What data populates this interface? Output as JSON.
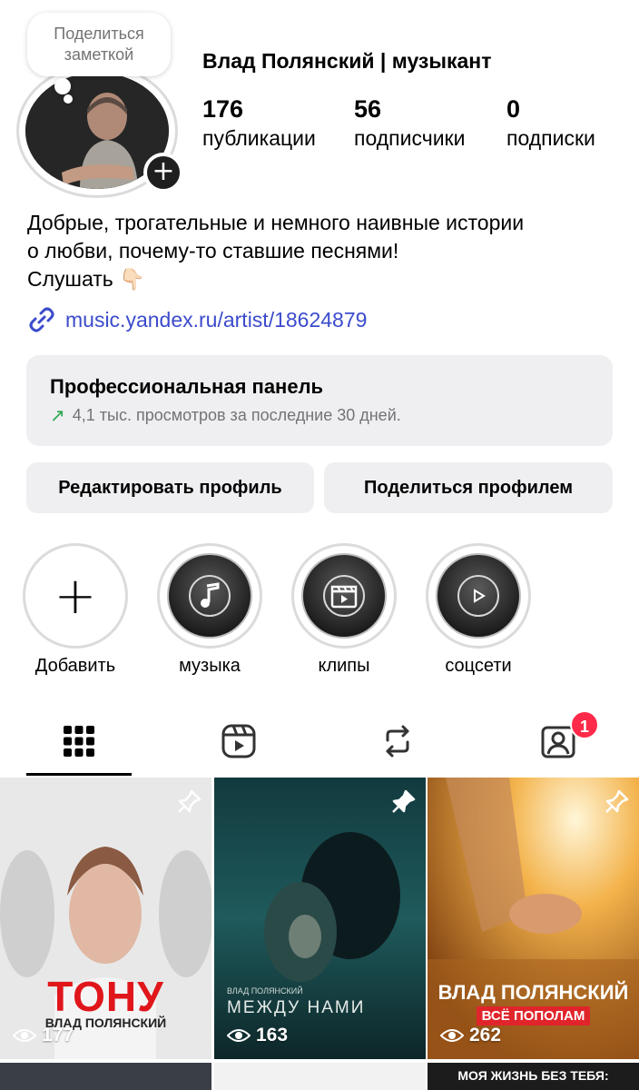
{
  "note": {
    "text_line1": "Поделиться",
    "text_line2": "заметкой"
  },
  "profile": {
    "name": "Влад Полянский | музыкант",
    "stats": {
      "posts_count": "176",
      "posts_label": "публикации",
      "followers_count": "56",
      "followers_label": "подписчики",
      "following_count": "0",
      "following_label": "подписки"
    },
    "bio_line1": "Добрые, трогательные и немного наивные истории",
    "bio_line2": "о любви, почему-то ставшие песнями!",
    "bio_line3": "Слушать 👇🏻",
    "link": "music.yandex.ru/artist/18624879"
  },
  "pro_panel": {
    "title": "Профессиональная панель",
    "subtitle": "4,1 тыс. просмотров за последние 30 дней."
  },
  "buttons": {
    "edit": "Редактировать профиль",
    "share": "Поделиться профилем"
  },
  "highlights": [
    {
      "label": "Добавить",
      "icon": "plus-icon"
    },
    {
      "label": "музыка",
      "icon": "music-note-icon"
    },
    {
      "label": "клипы",
      "icon": "clapperboard-icon"
    },
    {
      "label": "соцсети",
      "icon": "play-circle-icon"
    }
  ],
  "tabs": {
    "badge_count": "1",
    "icons": [
      "grid-icon",
      "reels-icon",
      "reposts-icon",
      "tagged-icon"
    ]
  },
  "posts": [
    {
      "views": "177",
      "title": "ТОНУ",
      "artist": "ВЛАД ПОЛЯНСКИЙ"
    },
    {
      "views": "163",
      "title": "МЕЖДУ НАМИ",
      "artist": "ВЛАД ПОЛЯНСКИЙ"
    },
    {
      "views": "262",
      "title": "ВЛАД ПОЛЯНСКИЙ",
      "subtitle": "ВСЁ ПОПОЛАМ"
    }
  ],
  "next_row_title": "МОЯ ЖИЗНЬ БЕЗ ТЕБЯ:",
  "colors": {
    "link": "#3b4bcc",
    "badge": "#ff2a4a",
    "panel": "#efeff2",
    "trend": "#2aa64a"
  }
}
